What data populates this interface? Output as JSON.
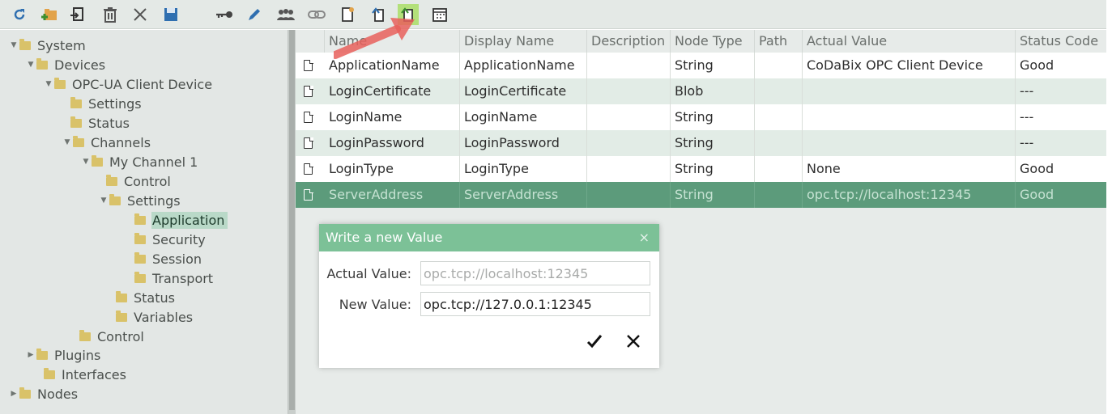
{
  "toolbar": {
    "icons": [
      "refresh-icon",
      "add-folder-icon",
      "add-node-icon",
      "delete-icon",
      "close-icon",
      "save-icon",
      "key-icon",
      "edit-icon",
      "users-icon",
      "link-icon",
      "new-document-icon",
      "read-value-icon",
      "write-value-icon",
      "calendar-icon"
    ],
    "highlighted": "write-value-icon",
    "accent_color": "#b3e07a"
  },
  "tree": {
    "nodes": [
      {
        "label": "System"
      },
      {
        "label": "Devices"
      },
      {
        "label": "OPC-UA Client Device"
      },
      {
        "label": "Settings"
      },
      {
        "label": "Status"
      },
      {
        "label": "Channels"
      },
      {
        "label": "My Channel 1"
      },
      {
        "label": "Control"
      },
      {
        "label": "Settings"
      },
      {
        "label": "Application",
        "selected": true
      },
      {
        "label": "Security"
      },
      {
        "label": "Session"
      },
      {
        "label": "Transport"
      },
      {
        "label": "Status"
      },
      {
        "label": "Variables"
      },
      {
        "label": "Control"
      },
      {
        "label": "Plugins"
      },
      {
        "label": "Interfaces"
      },
      {
        "label": "Nodes"
      }
    ]
  },
  "grid": {
    "columns": [
      "Name",
      "Display Name",
      "Description",
      "Node Type",
      "Path",
      "Actual Value",
      "Status Code"
    ],
    "rows": [
      {
        "name": "ApplicationName",
        "display_name": "ApplicationName",
        "description": "",
        "node_type": "String",
        "path": "",
        "actual_value": "CoDaBix OPC Client Device",
        "status_code": "Good"
      },
      {
        "name": "LoginCertificate",
        "display_name": "LoginCertificate",
        "description": "",
        "node_type": "Blob",
        "path": "",
        "actual_value": "",
        "status_code": "---"
      },
      {
        "name": "LoginName",
        "display_name": "LoginName",
        "description": "",
        "node_type": "String",
        "path": "",
        "actual_value": "",
        "status_code": "---"
      },
      {
        "name": "LoginPassword",
        "display_name": "LoginPassword",
        "description": "",
        "node_type": "String",
        "path": "",
        "actual_value": "",
        "status_code": "---"
      },
      {
        "name": "LoginType",
        "display_name": "LoginType",
        "description": "",
        "node_type": "String",
        "path": "",
        "actual_value": "None",
        "status_code": "Good"
      },
      {
        "name": "ServerAddress",
        "display_name": "ServerAddress",
        "description": "",
        "node_type": "String",
        "path": "",
        "actual_value": "opc.tcp://localhost:12345",
        "status_code": "Good",
        "selected": true
      }
    ],
    "selected_color": "#5c9b7b"
  },
  "dialog": {
    "title": "Write a new Value",
    "close_glyph": "×",
    "actual_value_label": "Actual Value:",
    "actual_value": "opc.tcp://localhost:12345",
    "new_value_label": "New Value:",
    "new_value": "opc.tcp://127.0.0.1:12345",
    "header_color": "#7cc197"
  }
}
